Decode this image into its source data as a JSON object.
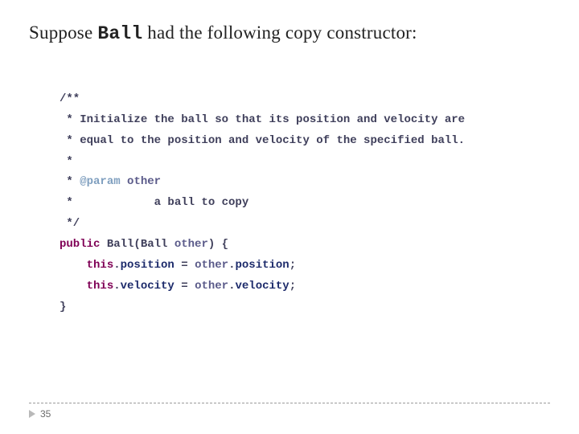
{
  "title": {
    "pre": "Suppose ",
    "code": "Ball",
    "post": " had the following copy constructor:"
  },
  "code": {
    "l1": "/**",
    "l2a": " * Initialize the ball so that its position and velocity are",
    "l3a": " * equal to the position and velocity of the specified ball.",
    "l4": " *",
    "l5a": " * ",
    "l5tag": "@param",
    "l5b": " ",
    "l5var": "other",
    "l6": " *            a ball to copy",
    "l7": " */",
    "l8kw": "public",
    "l8a": " Ball(Ball ",
    "l8var": "other",
    "l8b": ") {",
    "l9a": "    ",
    "l9kw1": "this",
    "l9b": ".",
    "l9f1": "position",
    "l9c": " = ",
    "l9var": "other",
    "l9d": ".",
    "l9f2": "position",
    "l9e": ";",
    "l10a": "    ",
    "l10kw1": "this",
    "l10b": ".",
    "l10f1": "velocity",
    "l10c": " = ",
    "l10var": "other",
    "l10d": ".",
    "l10f2": "velocity",
    "l10e": ";",
    "l11": "}"
  },
  "footer": {
    "page": "35"
  }
}
